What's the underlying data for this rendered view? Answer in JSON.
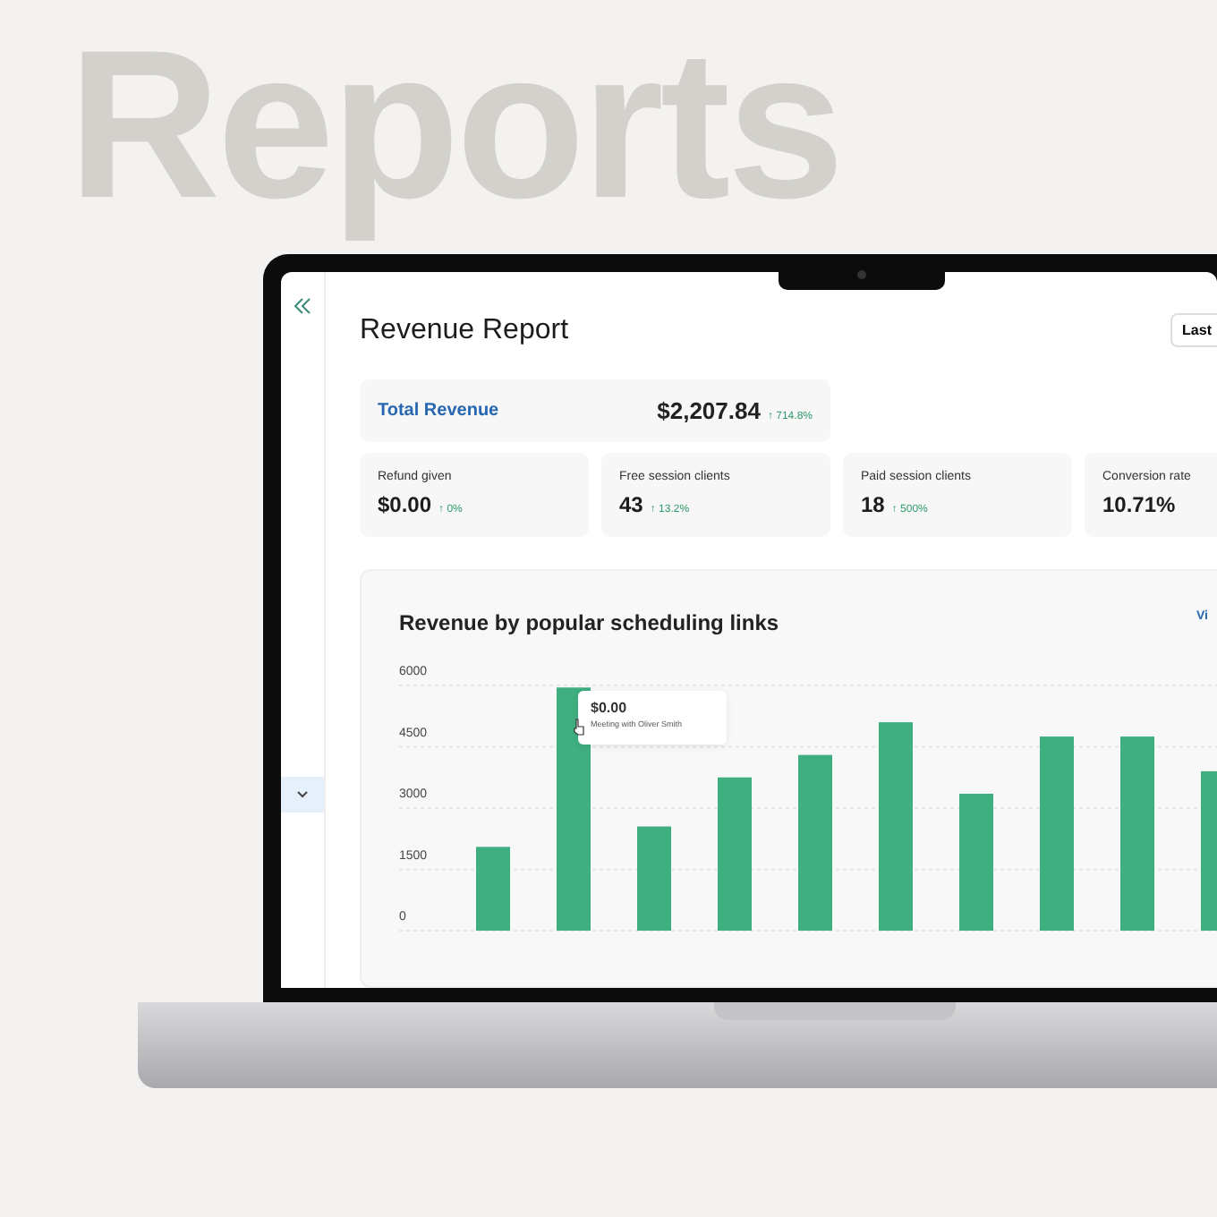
{
  "background_title": "Reports",
  "header": {
    "title": "Revenue Report",
    "date_button": "Last"
  },
  "total_revenue": {
    "label": "Total Revenue",
    "value": "$2,207.84",
    "change": "↑ 714.8%"
  },
  "stats": [
    {
      "label": "Refund given",
      "value": "$0.00",
      "change": "↑ 0%"
    },
    {
      "label": "Free session clients",
      "value": "43",
      "change": "↑ 13.2%"
    },
    {
      "label": "Paid session clients",
      "value": "18",
      "change": "↑ 500%"
    },
    {
      "label": "Conversion rate",
      "value": "10.71%"
    }
  ],
  "chart_panel": {
    "title": "Revenue by popular scheduling links",
    "link": "Vi",
    "tooltip": {
      "value": "$0.00",
      "label": "Meeting with Oliver Smith"
    },
    "chart_data": {
      "type": "bar",
      "grid": true,
      "ylim": [
        0,
        6000
      ],
      "yticks": [
        0,
        1500,
        3000,
        4500,
        6000
      ],
      "series": [
        {
          "color": "#3fae80",
          "values": [
            2050,
            5950,
            2550,
            3750,
            4300,
            5100,
            3350,
            4750,
            4750,
            3900
          ]
        }
      ]
    }
  }
}
